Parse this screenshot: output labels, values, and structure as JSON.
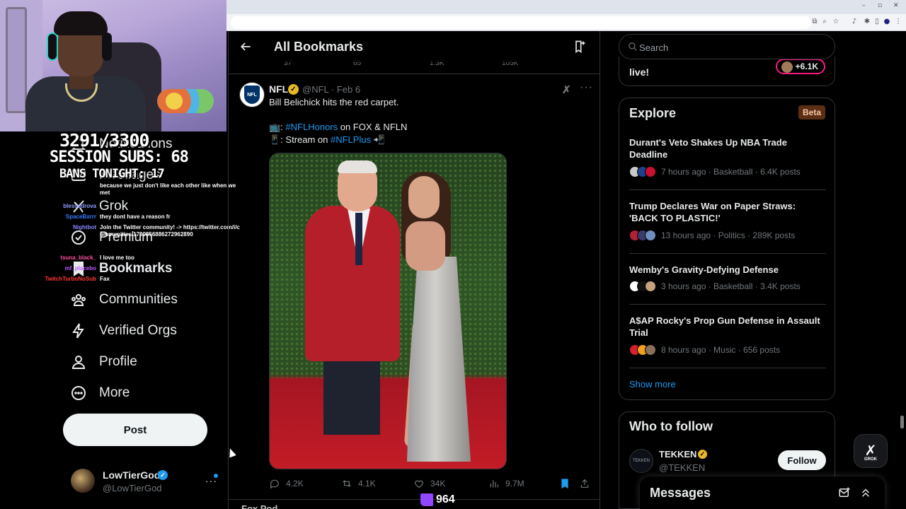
{
  "stream_overlay": {
    "goal_counter": "3291/3300",
    "session_subs": "SESSION SUBS: 68",
    "bans": "BANS TONIGHT: 17",
    "chat": [
      {
        "user": "",
        "color": "#ffffff",
        "message": "because we just don't like each other like when we met"
      },
      {
        "user": "blessedrova",
        "color": "#8fa0ff",
        "message": ""
      },
      {
        "user": "SpaceBxrrr",
        "color": "#3a7bff",
        "message": "they dont have a reason fr"
      },
      {
        "user": "Nightbot",
        "color": "#8a8aff",
        "message": "Join the Twitter community! -> https://twitter.com/i/communities/1780856886272962890"
      },
      {
        "user": "tsuna_black_",
        "color": "#ff4fa0",
        "message": "I love me too"
      },
      {
        "user": "mf_placebo",
        "color": "#bf5bff",
        "message": ""
      },
      {
        "user": "TwitchTurboNoSub",
        "color": "#ff3838",
        "message": "Fax"
      }
    ],
    "viewer_count": "964"
  },
  "nav": {
    "items": [
      {
        "label": "Notifications",
        "icon": "bell-icon"
      },
      {
        "label": "Messages",
        "icon": "envelope-icon"
      },
      {
        "label": "Grok",
        "icon": "grok-icon"
      },
      {
        "label": "Premium",
        "icon": "premium-icon"
      },
      {
        "label": "Bookmarks",
        "icon": "bookmark-icon"
      },
      {
        "label": "Communities",
        "icon": "communities-icon"
      },
      {
        "label": "Verified Orgs",
        "icon": "lightning-icon"
      },
      {
        "label": "Profile",
        "icon": "person-icon"
      },
      {
        "label": "More",
        "icon": "more-circle-icon"
      }
    ],
    "post_label": "Post",
    "account": {
      "name": "LowTierGod",
      "handle": "@LowTierGod"
    }
  },
  "header": {
    "title": "All Bookmarks",
    "back_icon": "back-arrow-icon",
    "add_icon": "add-bookmark-folder-icon"
  },
  "ghost_stats": {
    "replies": "37",
    "retweets": "65",
    "likes": "1.3K",
    "views": "105K"
  },
  "tweet": {
    "author": "NFL",
    "handle": "@NFL",
    "date": "· Feb 6",
    "text": "Bill Belichick hits the red carpet.",
    "line2_prefix": "📺: ",
    "line2_tag": "#NFLHonors",
    "line2_suffix": " on FOX & NFLN",
    "line3_prefix": "📱: Stream on ",
    "line3_tag": "#NFLPlus",
    "line3_suffix": " 📲",
    "stats": {
      "replies": "4.2K",
      "retweets": "4.1K",
      "likes": "34K",
      "views": "9.7M"
    }
  },
  "next_tweet": {
    "author": "Fox Pod..."
  },
  "search": {
    "placeholder": "Search"
  },
  "live_card": {
    "text": "live!",
    "count": "+6.1K"
  },
  "explore": {
    "title": "Explore",
    "badge": "Beta",
    "trends": [
      {
        "title": "Durant's Veto Shakes Up NBA Trade Deadline",
        "meta": "7 hours ago · Basketball · 6.4K posts",
        "faces": [
          "#c9c9c9",
          "#1d428a",
          "#c8102e"
        ]
      },
      {
        "title": "Trump Declares War on Paper Straws: 'BACK TO PLASTIC!'",
        "meta": "13 hours ago · Politics · 289K posts",
        "faces": [
          "#b22234",
          "#3c3b6e",
          "#6f8fbf"
        ]
      },
      {
        "title": "Wemby's Gravity-Defying Defense",
        "meta": "3 hours ago · Basketball · 3.4K posts",
        "faces": [
          "#ffffff",
          "#111111",
          "#c4a27e"
        ]
      },
      {
        "title": "A$AP Rocky's Prop Gun Defense in Assault Trial",
        "meta": "8 hours ago · Music · 656 posts",
        "faces": [
          "#d4202c",
          "#f0a020",
          "#8a6f5a"
        ]
      }
    ],
    "show_more": "Show more"
  },
  "who_to_follow": {
    "title": "Who to follow",
    "account": {
      "name": "TEKKEN",
      "handle": "@TEKKEN",
      "button": "Follow"
    }
  },
  "messages_drawer": {
    "title": "Messages"
  },
  "grok_fab": {
    "label": "GROK"
  }
}
